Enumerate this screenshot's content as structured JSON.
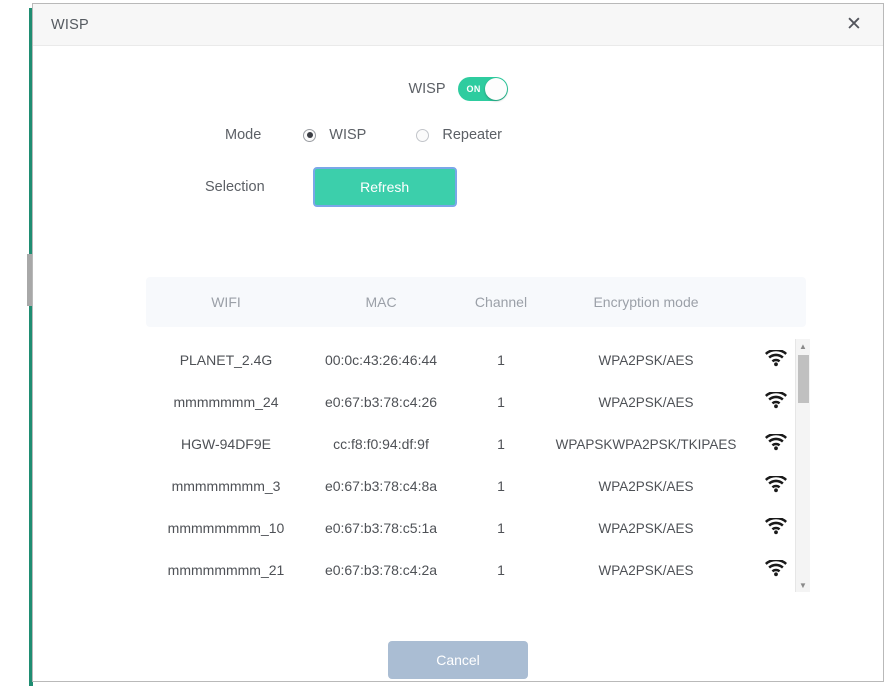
{
  "window": {
    "title": "WISP",
    "close_icon": "close-icon",
    "close_glyph": "✕"
  },
  "form": {
    "wisp_toggle": {
      "label": "WISP",
      "state_text": "ON",
      "enabled": true,
      "on_color": "#2ecc9f"
    },
    "mode": {
      "label": "Mode",
      "options": [
        {
          "label": "WISP",
          "selected": true
        },
        {
          "label": "Repeater",
          "selected": false
        }
      ]
    },
    "selection": {
      "label": "Selection",
      "refresh_label": "Refresh",
      "refresh_color": "#3ccfab"
    }
  },
  "table": {
    "columns": [
      "WIFI",
      "MAC",
      "Channel",
      "Encryption mode",
      ""
    ],
    "rows": [
      {
        "wifi": "PLANET_2.4G",
        "mac": "00:0c:43:26:46:44",
        "channel": "1",
        "encryption": "WPA2PSK/AES",
        "signal_icon": "wifi-icon"
      },
      {
        "wifi": "mmmmmmm_24",
        "mac": "e0:67:b3:78:c4:26",
        "channel": "1",
        "encryption": "WPA2PSK/AES",
        "signal_icon": "wifi-icon"
      },
      {
        "wifi": "HGW-94DF9E",
        "mac": "cc:f8:f0:94:df:9f",
        "channel": "1",
        "encryption": "WPAPSKWPA2PSK/TKIPAES",
        "signal_icon": "wifi-icon"
      },
      {
        "wifi": "mmmmmmmm_3",
        "mac": "e0:67:b3:78:c4:8a",
        "channel": "1",
        "encryption": "WPA2PSK/AES",
        "signal_icon": "wifi-icon"
      },
      {
        "wifi": "mmmmmmmm_10",
        "mac": "e0:67:b3:78:c5:1a",
        "channel": "1",
        "encryption": "WPA2PSK/AES",
        "signal_icon": "wifi-icon"
      },
      {
        "wifi": "mmmmmmmm_21",
        "mac": "e0:67:b3:78:c4:2a",
        "channel": "1",
        "encryption": "WPA2PSK/AES",
        "signal_icon": "wifi-icon"
      }
    ],
    "scrollbar": {
      "up_glyph": "▲",
      "down_glyph": "▼"
    }
  },
  "footer": {
    "cancel_label": "Cancel",
    "cancel_color": "#aabdd3"
  }
}
